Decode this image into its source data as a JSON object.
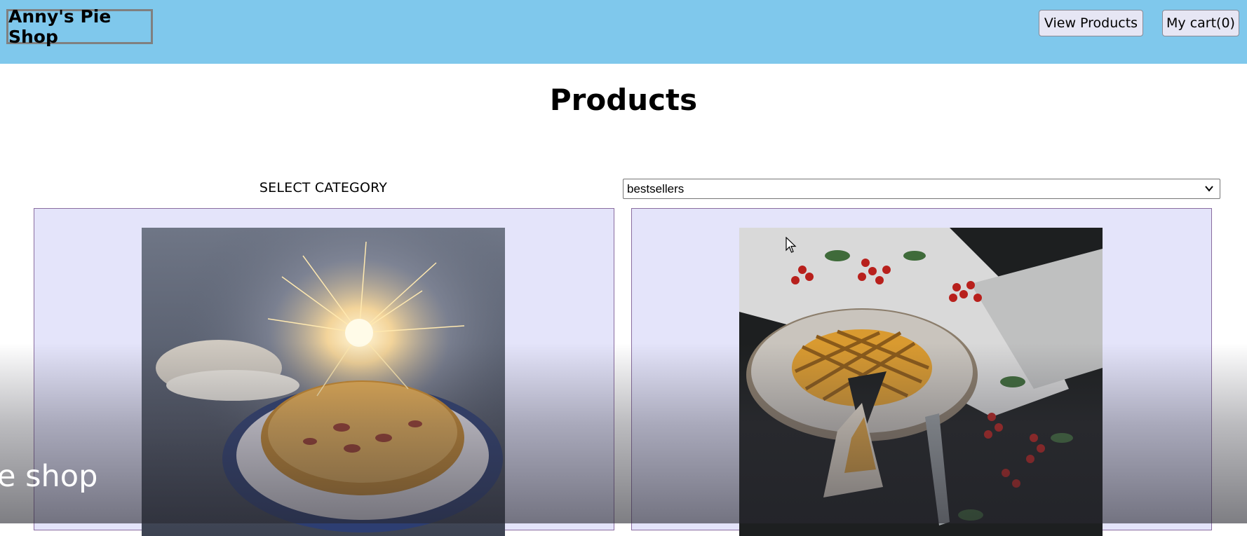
{
  "header": {
    "logo": "Anny's Pie Shop",
    "view_products_label": "View Products",
    "cart_label": "My cart(0)"
  },
  "main": {
    "title": "Products",
    "category_label": "SELECT CATEGORY",
    "category_selected": "bestsellers"
  },
  "products": [
    {
      "image": "pie-with-sparklers-image"
    },
    {
      "image": "lattice-pie-with-berries-image"
    }
  ],
  "overlay": {
    "text": "e shop"
  },
  "colors": {
    "header_bg": "#7fc8ec",
    "card_bg": "#e4e4fa",
    "card_border": "#8a6da0"
  }
}
